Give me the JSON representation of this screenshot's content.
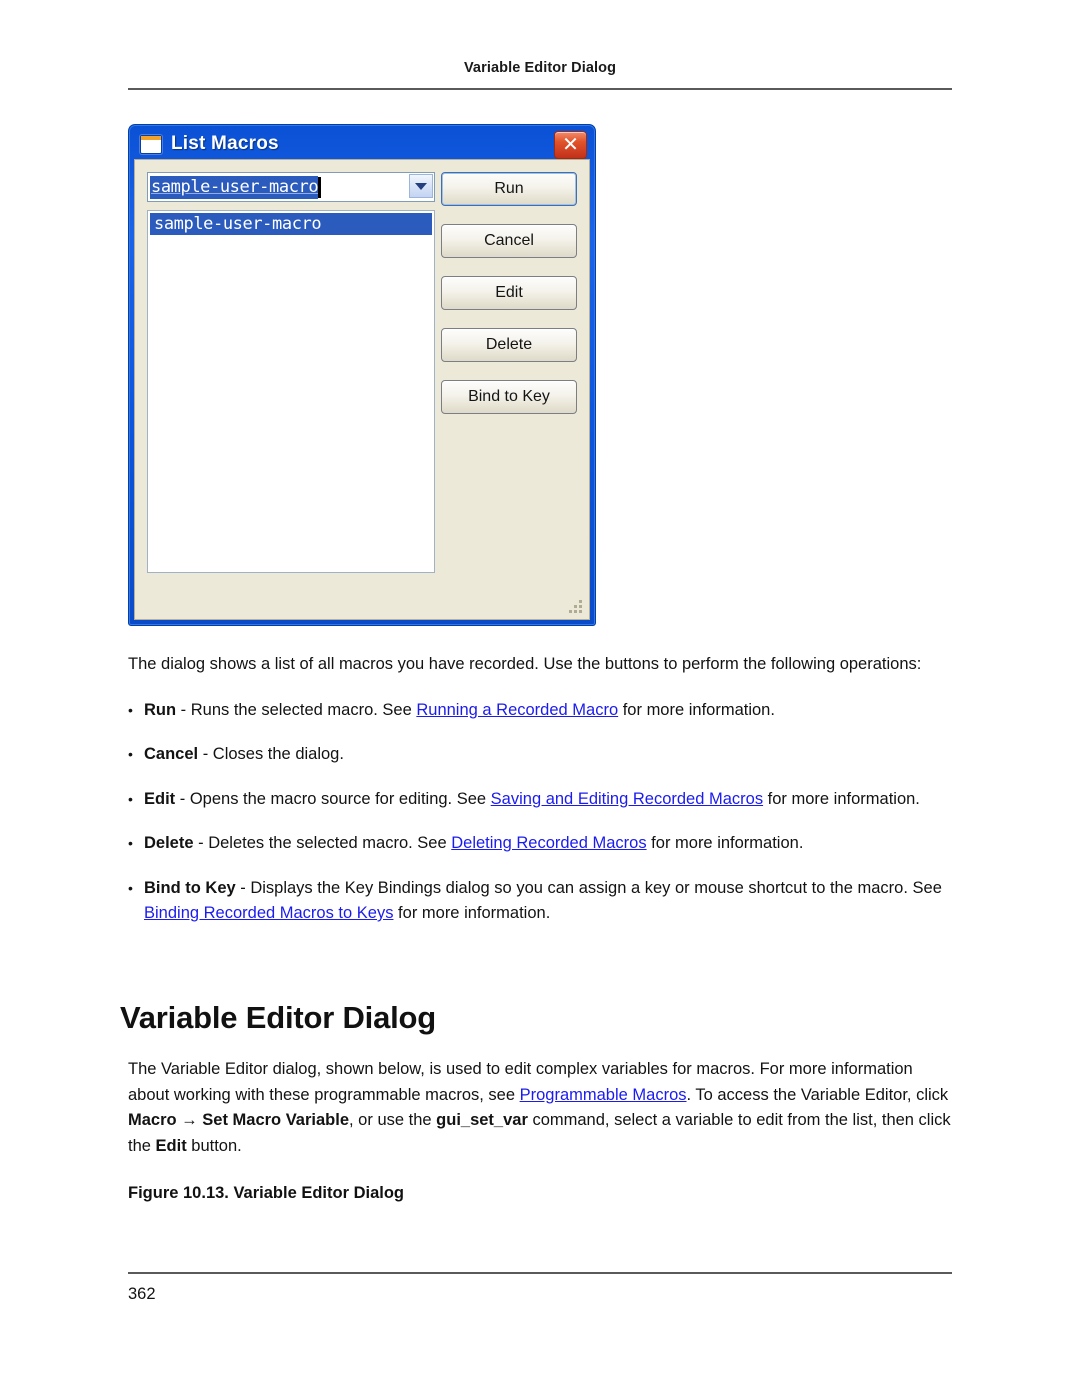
{
  "page": {
    "running_header": "Variable Editor Dialog",
    "page_number": "362"
  },
  "figure": {
    "dialog": {
      "title": "List Macros",
      "window_icon": "window-icon",
      "close_icon": "✕",
      "combo": {
        "value": "sample-user-macro",
        "arrow_icon": "chevron-down-icon"
      },
      "list_items": [
        "sample-user-macro"
      ],
      "buttons": [
        {
          "label": "Run",
          "focused": true
        },
        {
          "label": "Cancel",
          "focused": false
        },
        {
          "label": "Edit",
          "focused": false
        },
        {
          "label": "Delete",
          "focused": false
        },
        {
          "label": "Bind to Key",
          "focused": false
        }
      ],
      "resize_grip": "resize-grip"
    }
  },
  "body": {
    "intro": "The dialog shows a list of all macros you have recorded. Use the buttons to perform the following operations:",
    "bullets": [
      {
        "term": "Run",
        "text_before": " - Runs the selected macro. See ",
        "link": "Running a Recorded Macro",
        "text_after": " for more information."
      },
      {
        "term": "Cancel",
        "text_before": " - Closes the dialog.",
        "link": "",
        "text_after": ""
      },
      {
        "term": "Edit",
        "text_before": " - Opens the macro source for editing. See ",
        "link": "Saving and Editing Recorded Macros",
        "text_after": " for more information."
      },
      {
        "term": "Delete",
        "text_before": " - Deletes the selected macro. See ",
        "link": "Deleting Recorded Macros",
        "text_after": " for more information."
      },
      {
        "term": "Bind to Key",
        "text_before": " - Displays the Key Bindings dialog so you can assign a key or mouse shortcut to the macro. See ",
        "link": "Binding Recorded Macros to Keys",
        "text_after": " for more information."
      }
    ]
  },
  "section": {
    "title": "Variable Editor Dialog",
    "paragraph": {
      "p1": "The Variable Editor dialog, shown below, is used to edit complex variables for macros. For more information about working with these programmable macros, see ",
      "link1": "Programmable Macros",
      "p2": ". To access the Variable Editor, click ",
      "bold1": "Macro → Set Macro Variable",
      "p3": ", or use the ",
      "bold2": "gui_set_var",
      "p4": " command, select a variable to edit from the list, then click the ",
      "bold3": "Edit",
      "p5": " button."
    },
    "figure_caption": "Figure 10.13.  Variable Editor Dialog"
  }
}
